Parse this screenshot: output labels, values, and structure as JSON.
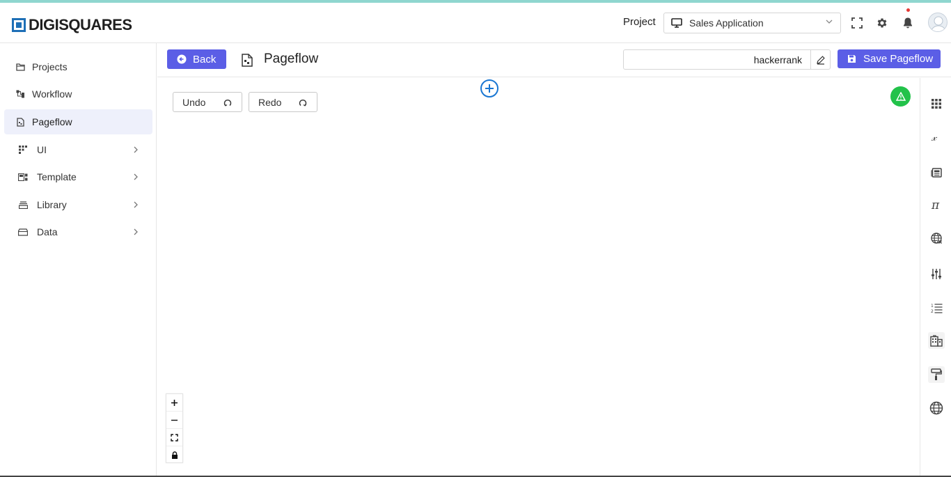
{
  "header": {
    "logo_text": "DIGISQUARES",
    "project_label": "Project",
    "project_select": {
      "value": "Sales Application"
    },
    "icons": [
      "fullscreen-icon",
      "gear-icon",
      "bell-icon",
      "avatar"
    ],
    "accent_color": "#5b5ee6",
    "brand_color": "#1e6fb6"
  },
  "sidebar": {
    "items": [
      {
        "label": "Projects",
        "icon": "folder-icon",
        "active": false
      },
      {
        "label": "Workflow",
        "icon": "workflow-icon",
        "active": false
      },
      {
        "label": "Pageflow",
        "icon": "page-icon",
        "active": true
      },
      {
        "label": "UI",
        "icon": "ui-grid-icon",
        "expandable": true
      },
      {
        "label": "Template",
        "icon": "template-icon",
        "expandable": true
      },
      {
        "label": "Library",
        "icon": "library-icon",
        "expandable": true
      },
      {
        "label": "Data",
        "icon": "data-icon",
        "expandable": true
      }
    ]
  },
  "toolbar": {
    "back_label": "Back",
    "title": "Pageflow",
    "name_value": "hackerrank",
    "save_label": "Save Pageflow"
  },
  "canvas": {
    "undo_label": "Undo",
    "redo_label": "Redo",
    "status_color": "#22c24a",
    "zoom_controls": [
      "zoom-in-icon",
      "zoom-out-icon",
      "fit-view-icon",
      "lock-icon"
    ]
  },
  "right_rail": {
    "icons": [
      "apps-grid-icon",
      "function-icon",
      "news-icon",
      "pi-icon",
      "globe-x-icon",
      "sliders-icon",
      "numbered-list-icon",
      "building-icon",
      "paint-roller-icon",
      "globe-icon"
    ]
  }
}
